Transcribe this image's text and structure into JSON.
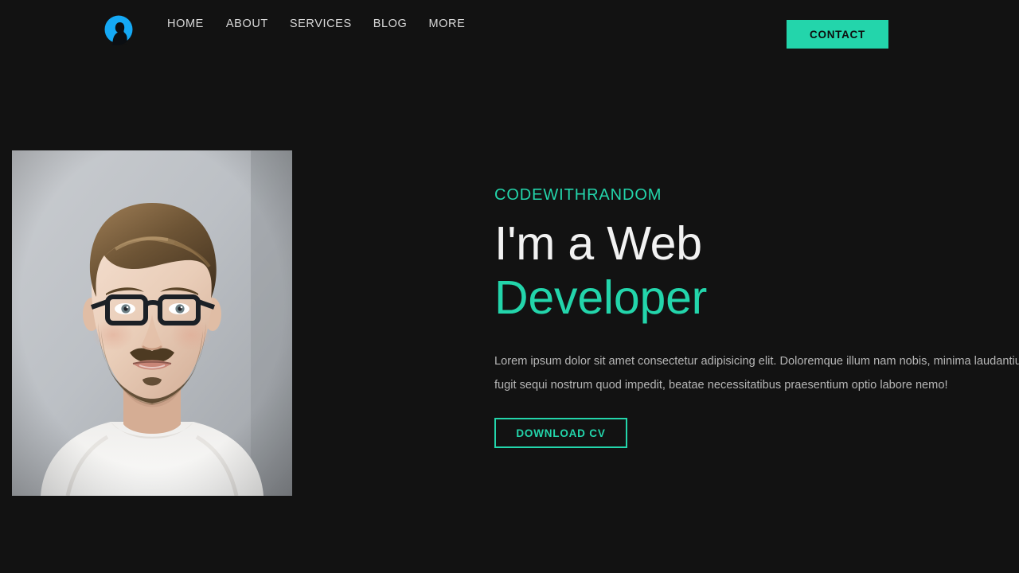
{
  "theme": {
    "background": "#121212",
    "accent": "#23d5ab",
    "logo_blue": "#15a9f5",
    "text_light": "#f2f2f2",
    "text_muted": "#b6b6b6"
  },
  "header": {
    "logo": {
      "icon": "person-avatar-icon",
      "alt": "Avatar logo"
    },
    "nav": [
      {
        "label": "HOME"
      },
      {
        "label": "ABOUT"
      },
      {
        "label": "SERVICES"
      },
      {
        "label": "BLOG"
      },
      {
        "label": "MORE"
      }
    ],
    "contact_button": "CONTACT"
  },
  "hero": {
    "photo": {
      "icon": "portrait-photo",
      "alt": "Portrait of a bearded man wearing glasses and a white t-shirt against a grey wall"
    },
    "eyebrow": "CODEWITHRANDOM",
    "headline_line_1": "I'm a Web",
    "headline_line_2": "Developer",
    "paragraph": "Lorem ipsum dolor sit amet consectetur adipisicing elit. Doloremque illum nam nobis, minima laudantium fugit sequi nostrum quod impedit, beatae necessitatibus praesentium optio labore nemo!",
    "cta_button": "DOWNLOAD CV"
  }
}
